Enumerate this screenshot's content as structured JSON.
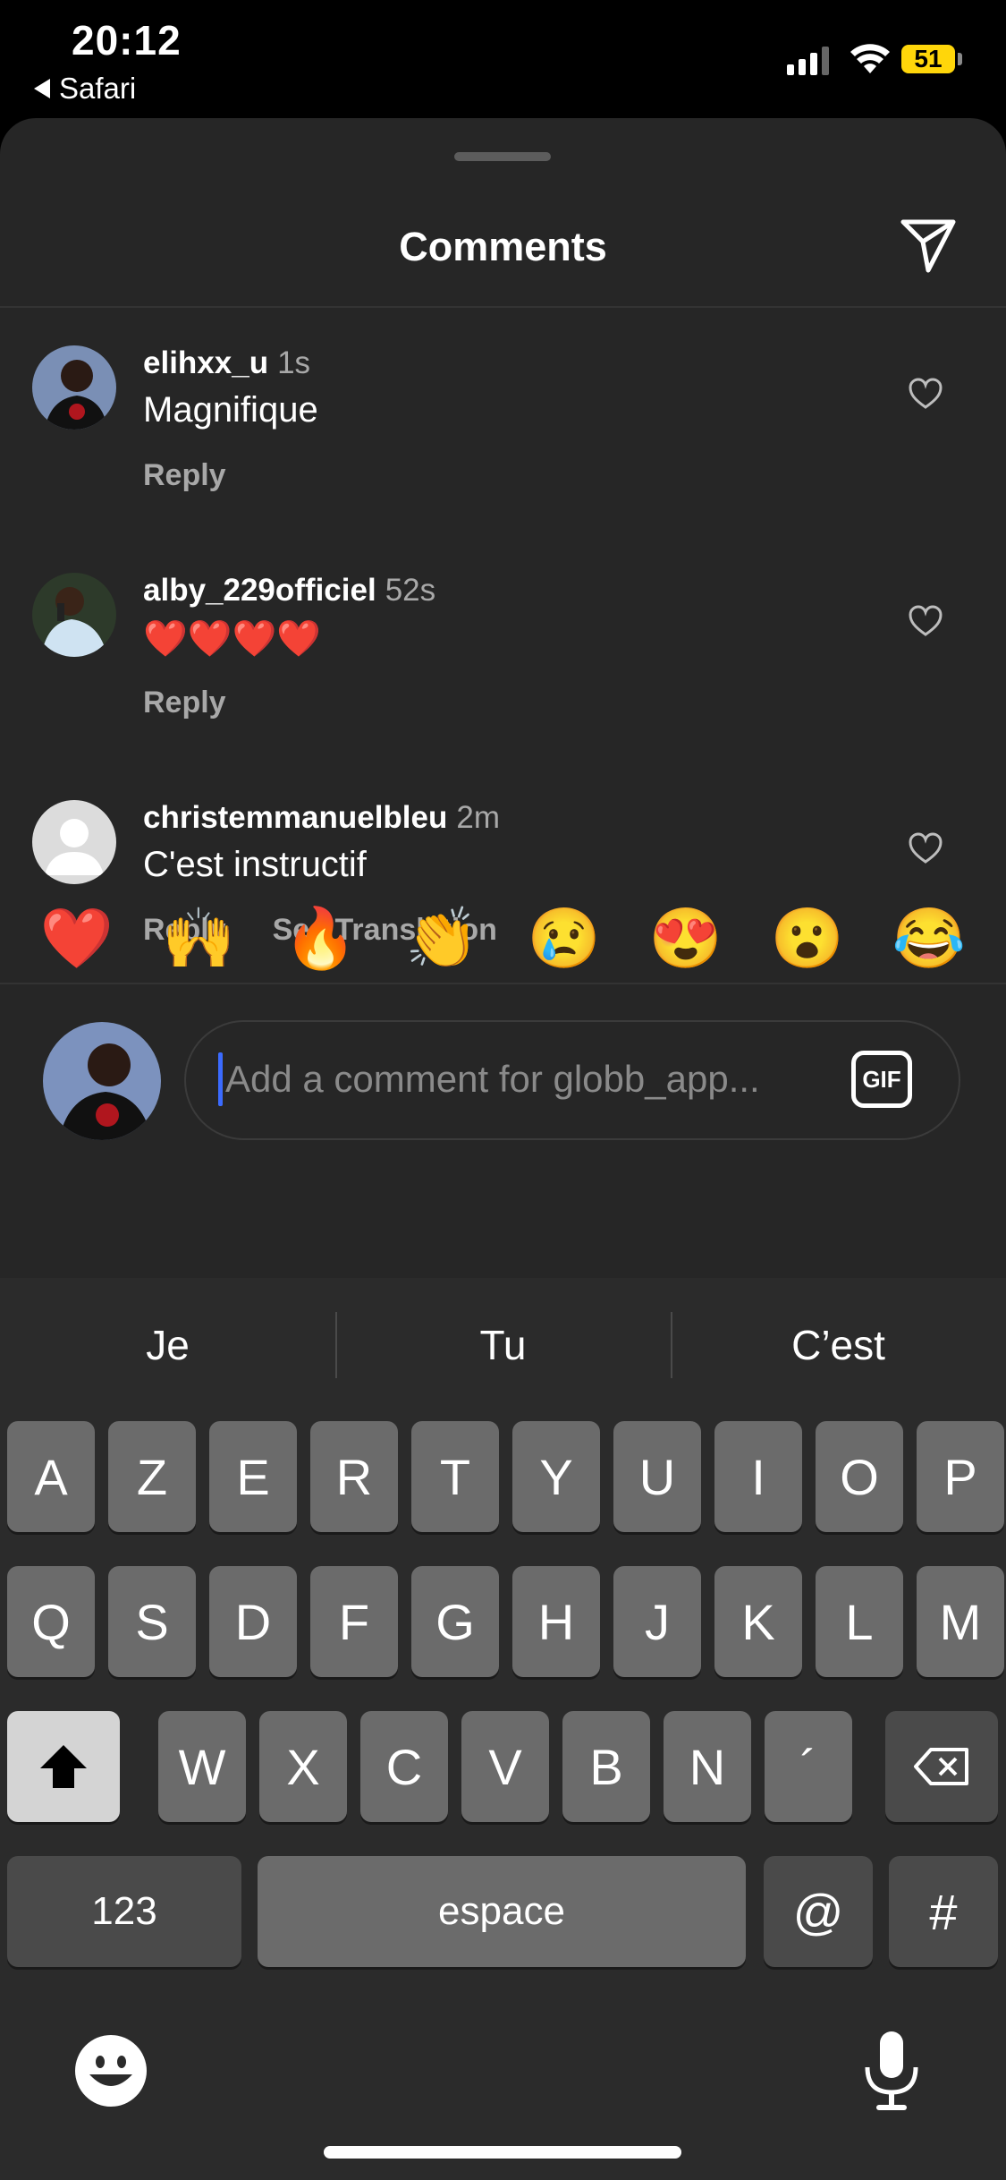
{
  "status": {
    "time": "20:12",
    "back_app": "Safari",
    "battery": "51"
  },
  "sheet": {
    "title": "Comments"
  },
  "comments": [
    {
      "username": "elihxx_u",
      "timestamp": "1s",
      "text": "Magnifique",
      "reply": "Reply"
    },
    {
      "username": "alby_229officiel",
      "timestamp": "52s",
      "text": "❤️❤️❤️❤️",
      "reply": "Reply"
    },
    {
      "username": "christemmanuelbleu",
      "timestamp": "2m",
      "text": "C'est instructif",
      "reply": "Reply",
      "translate": "See Translation"
    }
  ],
  "quick_reactions": [
    "❤️",
    "🙌",
    "🔥",
    "👏",
    "😢",
    "😍",
    "😮",
    "😂"
  ],
  "composer": {
    "placeholder": "Add a comment for globb_app...",
    "gif_label": "GIF"
  },
  "keyboard": {
    "suggestions": [
      "Je",
      "Tu",
      "C’est"
    ],
    "row1": [
      "A",
      "Z",
      "E",
      "R",
      "T",
      "Y",
      "U",
      "I",
      "O",
      "P"
    ],
    "row2": [
      "Q",
      "S",
      "D",
      "F",
      "G",
      "H",
      "J",
      "K",
      "L",
      "M"
    ],
    "row3": [
      "W",
      "X",
      "C",
      "V",
      "B",
      "N",
      "´"
    ],
    "numbers_label": "123",
    "space_label": "espace",
    "at_label": "@",
    "hash_label": "#"
  },
  "colors": {
    "sheet_bg": "#262626",
    "battery": "#ffd60a",
    "cursor": "#3b6bff"
  }
}
